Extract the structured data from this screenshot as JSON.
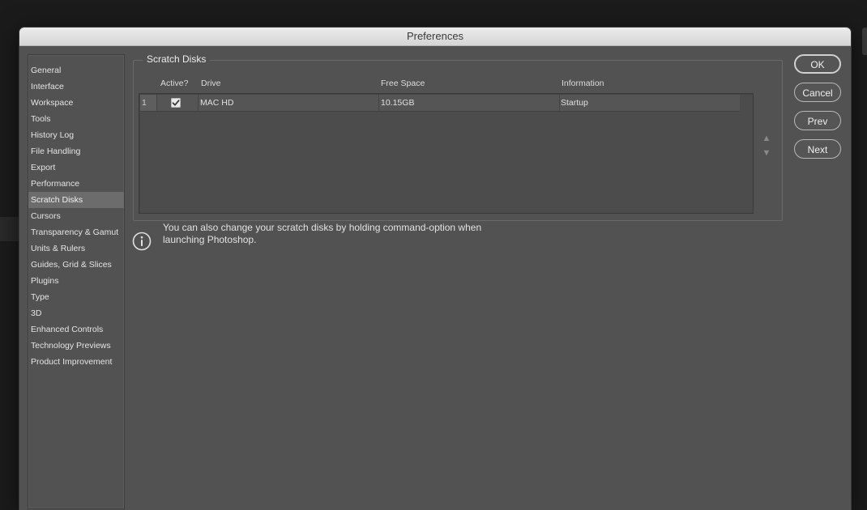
{
  "window": {
    "title": "Preferences"
  },
  "sidebar": {
    "items": [
      {
        "label": "General",
        "selected": false
      },
      {
        "label": "Interface",
        "selected": false
      },
      {
        "label": "Workspace",
        "selected": false
      },
      {
        "label": "Tools",
        "selected": false
      },
      {
        "label": "History Log",
        "selected": false
      },
      {
        "label": "File Handling",
        "selected": false
      },
      {
        "label": "Export",
        "selected": false
      },
      {
        "label": "Performance",
        "selected": false
      },
      {
        "label": "Scratch Disks",
        "selected": true
      },
      {
        "label": "Cursors",
        "selected": false
      },
      {
        "label": "Transparency & Gamut",
        "selected": false
      },
      {
        "label": "Units & Rulers",
        "selected": false
      },
      {
        "label": "Guides, Grid & Slices",
        "selected": false
      },
      {
        "label": "Plugins",
        "selected": false
      },
      {
        "label": "Type",
        "selected": false
      },
      {
        "label": "3D",
        "selected": false
      },
      {
        "label": "Enhanced Controls",
        "selected": false
      },
      {
        "label": "Technology Previews",
        "selected": false
      },
      {
        "label": "Product Improvement",
        "selected": false
      }
    ]
  },
  "scratch_disks": {
    "title": "Scratch Disks",
    "columns": {
      "active": "Active?",
      "drive": "Drive",
      "free_space": "Free Space",
      "information": "Information"
    },
    "rows": [
      {
        "index": "1",
        "active": true,
        "drive": "MAC HD",
        "free_space": "10.15GB",
        "information": "Startup"
      }
    ],
    "move_up_icon": "triangle-up-icon",
    "move_down_icon": "triangle-down-icon"
  },
  "info": {
    "icon": "info-icon",
    "text": "You can also change your scratch disks by holding command-option when launching Photoshop."
  },
  "buttons": {
    "ok": "OK",
    "cancel": "Cancel",
    "prev": "Prev",
    "next": "Next"
  }
}
